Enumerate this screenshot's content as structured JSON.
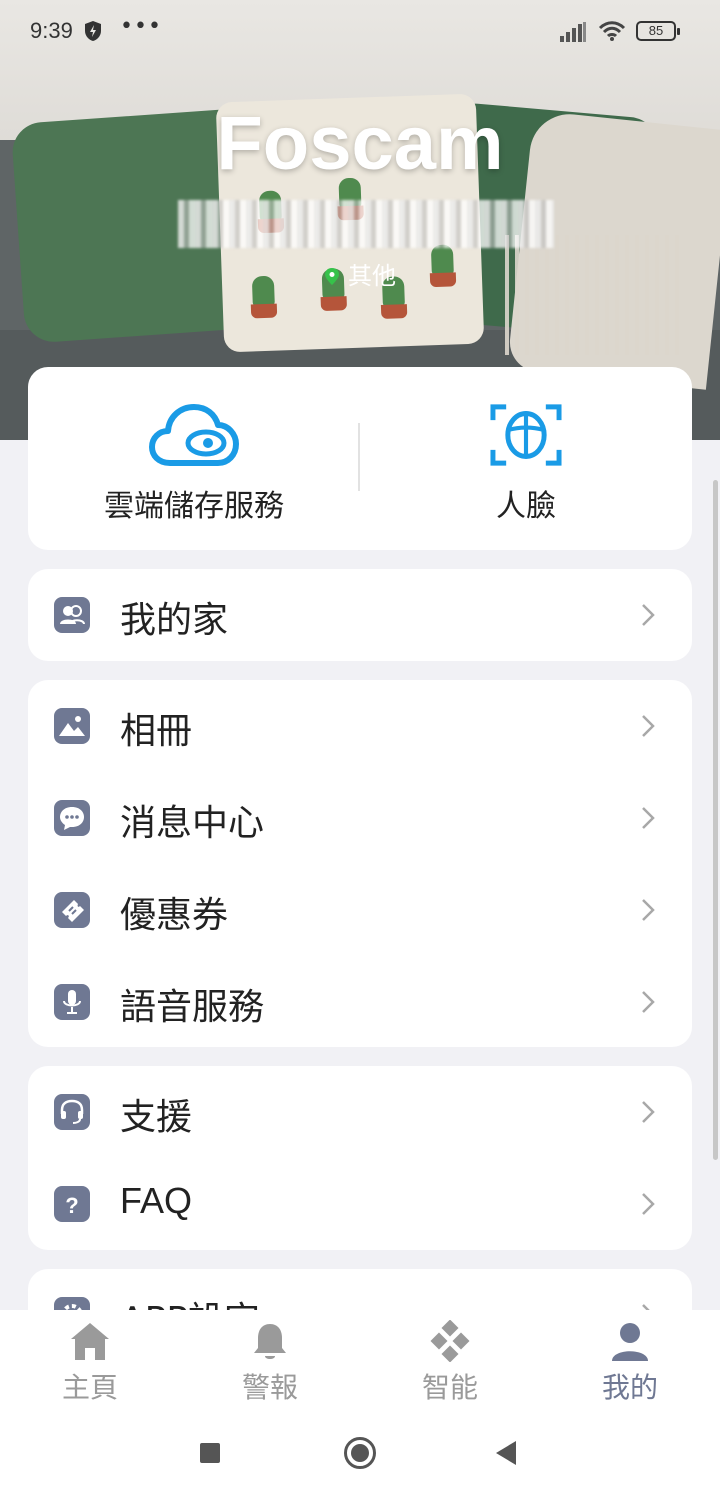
{
  "status_bar": {
    "time": "9:39",
    "dots": "•••",
    "battery": "85"
  },
  "profile": {
    "brand": "Foscam",
    "account_masked": "account",
    "location": "其他"
  },
  "services": [
    {
      "label": "雲端儲存服務",
      "icon": "cloud-eye-icon"
    },
    {
      "label": "人臉",
      "icon": "face-scan-icon"
    }
  ],
  "menu": {
    "group1": [
      {
        "label": "我的家",
        "icon": "family-icon"
      }
    ],
    "group2": [
      {
        "label": "相冊",
        "icon": "photo-icon"
      },
      {
        "label": "消息中心",
        "icon": "chat-icon"
      },
      {
        "label": "優惠券",
        "icon": "ticket-icon"
      },
      {
        "label": "語音服務",
        "icon": "mic-icon"
      }
    ],
    "group3": [
      {
        "label": "支援",
        "icon": "headset-icon"
      },
      {
        "label": "FAQ",
        "icon": "question-icon"
      }
    ],
    "group4": [
      {
        "label": "APP設定",
        "icon": "gear-icon"
      }
    ]
  },
  "tabs": [
    {
      "label": "主頁",
      "icon": "home-icon"
    },
    {
      "label": "警報",
      "icon": "bell-icon"
    },
    {
      "label": "智能",
      "icon": "smart-diamond-icon"
    },
    {
      "label": "我的",
      "icon": "person-icon",
      "active": true
    }
  ],
  "colors": {
    "accent": "#1a9be6",
    "icon_bg": "#6f7893",
    "active_tab": "#6f7893",
    "inactive_tab": "#9a9a9a"
  }
}
